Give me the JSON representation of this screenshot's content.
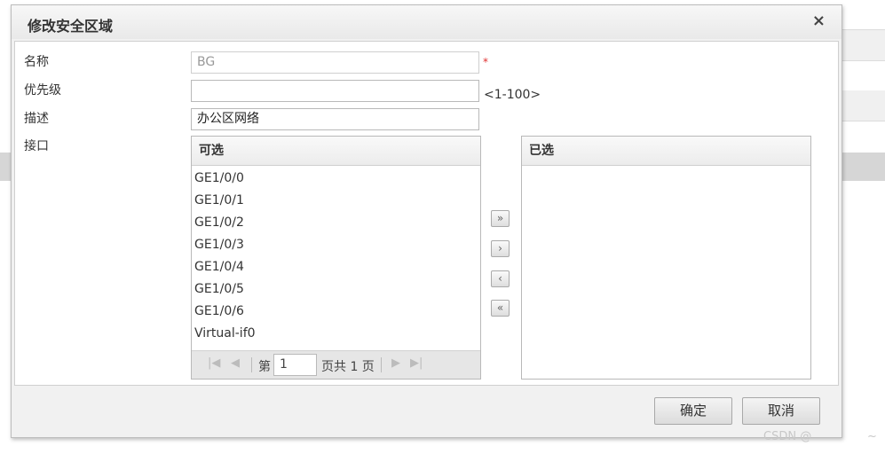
{
  "dialog": {
    "title": "修改安全区域",
    "close_icon": "close-icon",
    "close_glyph": "×"
  },
  "form": {
    "name_label": "名称",
    "name_value": "BG",
    "required_mark": "*",
    "priority_label": "优先级",
    "priority_value": "",
    "priority_hint": "<1-100>",
    "desc_label": "描述",
    "desc_value": "办公区网络",
    "interface_label": "接口"
  },
  "available": {
    "header": "可选",
    "items": [
      "GE1/0/0",
      "GE1/0/1",
      "GE1/0/2",
      "GE1/0/3",
      "GE1/0/4",
      "GE1/0/5",
      "GE1/0/6",
      "Virtual-if0"
    ]
  },
  "selected": {
    "header": "已选",
    "items": []
  },
  "pager": {
    "first_icon": "first-page-icon",
    "prev_icon": "prev-page-icon",
    "next_icon": "next-page-icon",
    "last_icon": "last-page-icon",
    "page_prefix": "第",
    "page_value": "1",
    "page_suffix": "页共 1 页"
  },
  "move_buttons": {
    "move_all_right": "»",
    "move_right": "›",
    "move_left": "‹",
    "move_all_left": "«"
  },
  "footer": {
    "ok_label": "确定",
    "cancel_label": "取消"
  },
  "watermark": {
    "text": "CSDN @",
    "tail": "~"
  }
}
